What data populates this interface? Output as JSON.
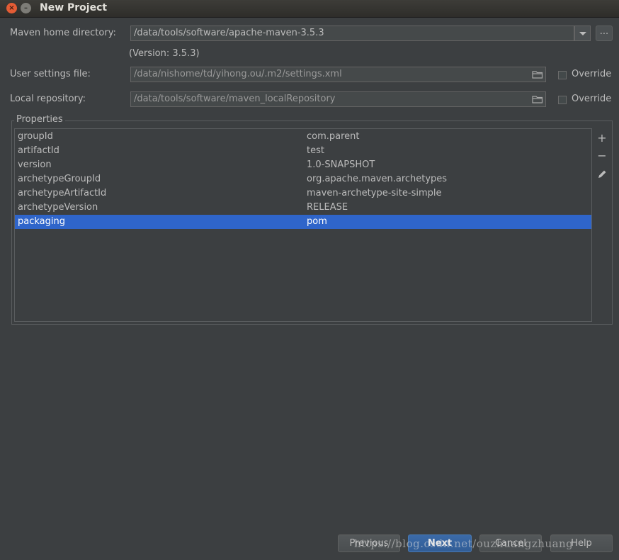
{
  "window": {
    "title": "New Project"
  },
  "maven": {
    "home_label": "Maven home directory:",
    "home_value": "/data/tools/software/apache-maven-3.5.3",
    "dots_label": "...",
    "version_text": "(Version: 3.5.3)",
    "settings_label": "User settings file:",
    "settings_value": "/data/nishome/td/yihong.ou/.m2/settings.xml",
    "settings_override": "Override",
    "repo_label": "Local repository:",
    "repo_value": "/data/tools/software/maven_localRepository",
    "repo_override": "Override"
  },
  "properties": {
    "title": "Properties",
    "rows": [
      {
        "key": "groupId",
        "value": "com.parent"
      },
      {
        "key": "artifactId",
        "value": "test"
      },
      {
        "key": "version",
        "value": "1.0-SNAPSHOT"
      },
      {
        "key": "archetypeGroupId",
        "value": "org.apache.maven.archetypes"
      },
      {
        "key": "archetypeArtifactId",
        "value": "maven-archetype-site-simple"
      },
      {
        "key": "archetypeVersion",
        "value": "RELEASE"
      },
      {
        "key": "packaging",
        "value": "pom"
      }
    ],
    "selected_row": "packaging"
  },
  "footer": {
    "previous": "Previous",
    "next": "Next",
    "cancel": "Cancel",
    "help": "Help"
  },
  "watermark": "https://blog.csdn.net/ouzhuangzhuang",
  "colors": {
    "background": "#3c3f41",
    "selection": "#2f65ca",
    "default_button": "#3b6aa8"
  }
}
